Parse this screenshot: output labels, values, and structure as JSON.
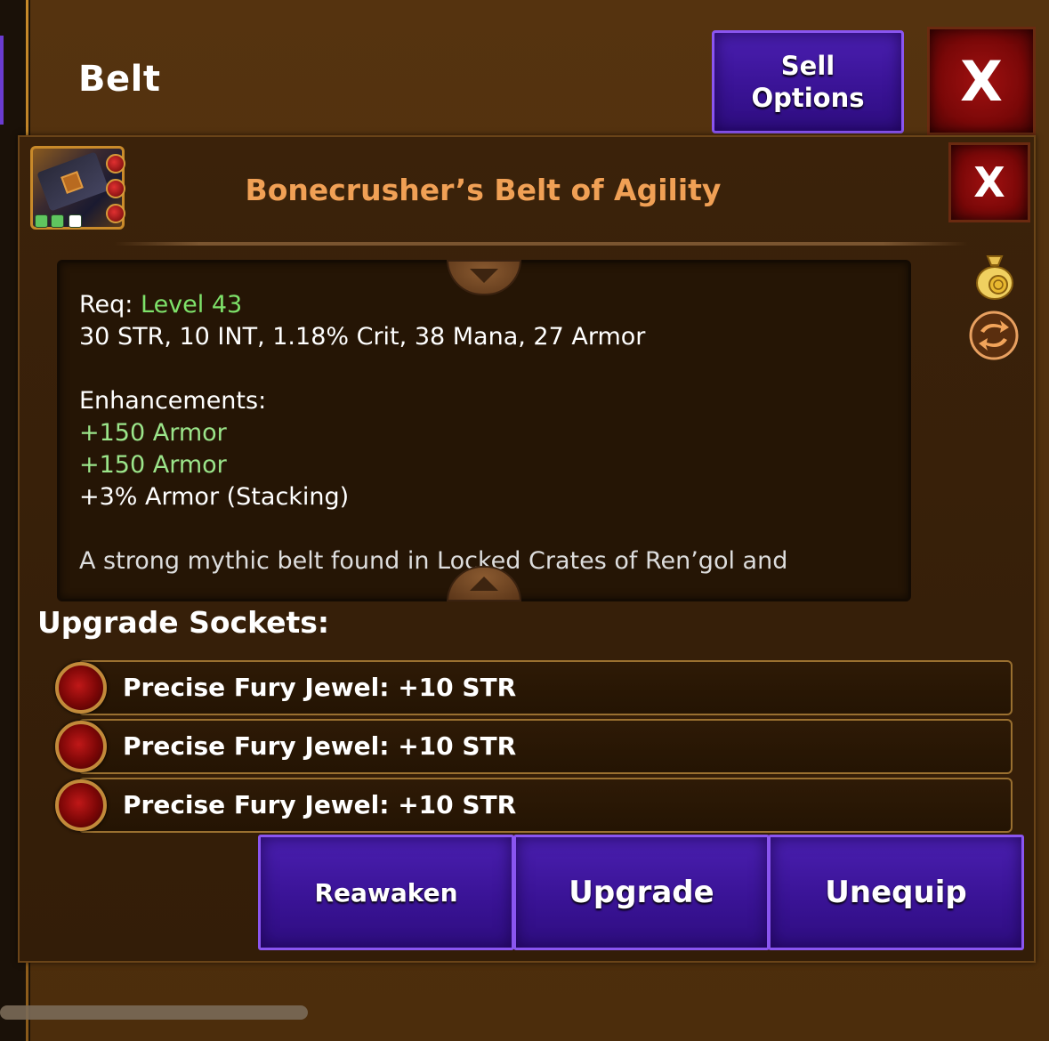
{
  "header": {
    "title": "Belt",
    "sell_label_line1": "Sell",
    "sell_label_line2": "Options",
    "close_label": "X"
  },
  "item": {
    "name": "Bonecrusher’s Belt of Agility",
    "close_label": "X",
    "rarity_pips": [
      "#5fc55f",
      "#5fc55f",
      "#ffffff"
    ],
    "title_color": "#f0a055"
  },
  "description": {
    "req_prefix": "Req:",
    "req_value": "Level 43",
    "stats": "30 STR, 10 INT, 1.18% Crit, 38 Mana, 27 Armor",
    "enh_title": "Enhancements:",
    "enh_1": "+150 Armor",
    "enh_2": "+150 Armor",
    "enh_3": "+3% Armor (Stacking)",
    "flavor": "A strong mythic belt found in Locked Crates of Ren’gol and"
  },
  "sockets": {
    "title": "Upgrade Sockets:",
    "items": [
      {
        "label": "Precise Fury Jewel: +10 STR"
      },
      {
        "label": "Precise Fury Jewel: +10 STR"
      },
      {
        "label": "Precise Fury Jewel: +10 STR"
      }
    ]
  },
  "actions": {
    "reawaken": "Reawaken",
    "upgrade": "Upgrade",
    "unequip": "Unequip"
  },
  "icons": {
    "sell": "coin-bag-icon",
    "swap": "swap-arrows-icon"
  }
}
